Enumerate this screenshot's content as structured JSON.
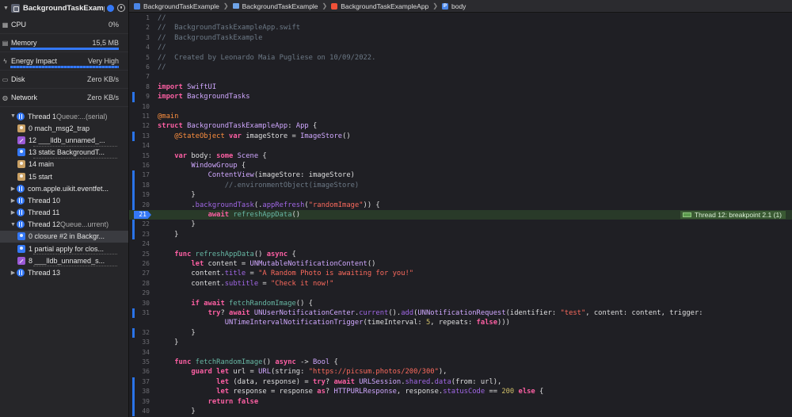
{
  "navigator": {
    "title": "BackgroundTaskExample",
    "pause_glyph": "⏸",
    "gauges": [
      {
        "name": "CPU",
        "value": "0%",
        "icon": "cpu-icon",
        "bar": 0
      },
      {
        "name": "Memory",
        "value": "15,5 MB",
        "icon": "memory-icon",
        "bar": 1
      },
      {
        "name": "Energy Impact",
        "value": "Very High",
        "icon": "energy-icon",
        "bar": 1
      },
      {
        "name": "Disk",
        "value": "Zero KB/s",
        "icon": "disk-icon",
        "bar": 0
      },
      {
        "name": "Network",
        "value": "Zero KB/s",
        "icon": "network-icon",
        "bar": 0
      }
    ],
    "tree": [
      {
        "kind": "thread",
        "label": "Thread 1",
        "sub": "Queue:...(serial)",
        "expanded": true
      },
      {
        "kind": "frame",
        "color": "tan",
        "label": "0 mach_msg2_trap"
      },
      {
        "kind": "frame",
        "color": "purple",
        "label": "12 ___lldb_unnamed_..."
      },
      {
        "kind": "frame",
        "color": "blue",
        "label": "13 static BackgroundT..."
      },
      {
        "kind": "frame",
        "color": "tan",
        "label": "14 main"
      },
      {
        "kind": "frame",
        "color": "tan",
        "label": "15 start"
      },
      {
        "kind": "thread",
        "label": "com.apple.uikit.eventfet...",
        "sub": "",
        "expanded": false
      },
      {
        "kind": "thread",
        "label": "Thread 10",
        "sub": "",
        "expanded": false
      },
      {
        "kind": "thread",
        "label": "Thread 11",
        "sub": "",
        "expanded": false
      },
      {
        "kind": "thread",
        "label": "Thread 12",
        "sub": "Queue...urrent)",
        "expanded": true
      },
      {
        "kind": "frame",
        "color": "blue",
        "label": "0 closure #2 in Backgr...",
        "selected": true
      },
      {
        "kind": "frame",
        "color": "blue",
        "label": "1 partial apply for clos..."
      },
      {
        "kind": "frame",
        "color": "purple",
        "label": "8 ___lldb_unnamed_s..."
      },
      {
        "kind": "thread",
        "label": "Thread 13",
        "sub": "",
        "expanded": false
      }
    ]
  },
  "jumpbar": {
    "items": [
      "BackgroundTaskExample",
      "BackgroundTaskExample",
      "BackgroundTaskExampleApp",
      "body"
    ],
    "body_glyph": "P"
  },
  "editor": {
    "breakpoint_line": 21,
    "breakpoint_label": "Thread 12: breakpoint 2.1 (1)",
    "changed_lines": [
      9,
      13,
      17,
      18,
      19,
      20,
      21,
      22,
      23,
      31,
      32,
      37,
      38,
      39,
      40
    ],
    "lines": [
      {
        "n": "1",
        "code": "//"
      },
      {
        "n": "2",
        "code": "//  BackgroundTaskExampleApp.swift"
      },
      {
        "n": "3",
        "code": "//  BackgroundTaskExample"
      },
      {
        "n": "4",
        "code": "//"
      },
      {
        "n": "5",
        "code": "//  Created by Leonardo Maia Pugliese on 10/09/2022."
      },
      {
        "n": "6",
        "code": "//"
      },
      {
        "n": "7",
        "code": ""
      },
      {
        "n": "8",
        "code": "import SwiftUI"
      },
      {
        "n": "9",
        "code": "import BackgroundTasks"
      },
      {
        "n": "10",
        "code": ""
      },
      {
        "n": "11",
        "code": "@main"
      },
      {
        "n": "12",
        "code": "struct BackgroundTaskExampleApp: App {"
      },
      {
        "n": "13",
        "code": "    @StateObject var imageStore = ImageStore()"
      },
      {
        "n": "14",
        "code": ""
      },
      {
        "n": "15",
        "code": "    var body: some Scene {"
      },
      {
        "n": "16",
        "code": "        WindowGroup {"
      },
      {
        "n": "17",
        "code": "            ContentView(imageStore: imageStore)"
      },
      {
        "n": "18",
        "code": "                //.environmentObject(imageStore)"
      },
      {
        "n": "19",
        "code": "        }"
      },
      {
        "n": "20",
        "code": "        .backgroundTask(.appRefresh(\"randomImage\")) {"
      },
      {
        "n": "21",
        "code": "            await refreshAppData()"
      },
      {
        "n": "22",
        "code": "        }"
      },
      {
        "n": "23",
        "code": "    }"
      },
      {
        "n": "24",
        "code": ""
      },
      {
        "n": "25",
        "code": "    func refreshAppData() async {"
      },
      {
        "n": "26",
        "code": "        let content = UNMutableNotificationContent()"
      },
      {
        "n": "27",
        "code": "        content.title = \"A Random Photo is awaiting for you!\""
      },
      {
        "n": "28",
        "code": "        content.subtitle = \"Check it now!\""
      },
      {
        "n": "29",
        "code": ""
      },
      {
        "n": "30",
        "code": "        if await fetchRandomImage() {"
      },
      {
        "n": "31",
        "code": "            try? await UNUserNotificationCenter.current().add(UNNotificationRequest(identifier: \"test\", content: content, trigger:"
      },
      {
        "n": "",
        "code": "                UNTimeIntervalNotificationTrigger(timeInterval: 5, repeats: false)))"
      },
      {
        "n": "32",
        "code": "        }"
      },
      {
        "n": "33",
        "code": "    }"
      },
      {
        "n": "34",
        "code": ""
      },
      {
        "n": "35",
        "code": "    func fetchRandomImage() async -> Bool {"
      },
      {
        "n": "36",
        "code": "        guard let url = URL(string: \"https://picsum.photos/200/300\"),"
      },
      {
        "n": "37",
        "code": "              let (data, response) = try? await URLSession.shared.data(from: url),"
      },
      {
        "n": "38",
        "code": "              let response = response as? HTTPURLResponse, response.statusCode == 200 else {"
      },
      {
        "n": "39",
        "code": "            return false"
      },
      {
        "n": "40",
        "code": "        }"
      }
    ]
  }
}
